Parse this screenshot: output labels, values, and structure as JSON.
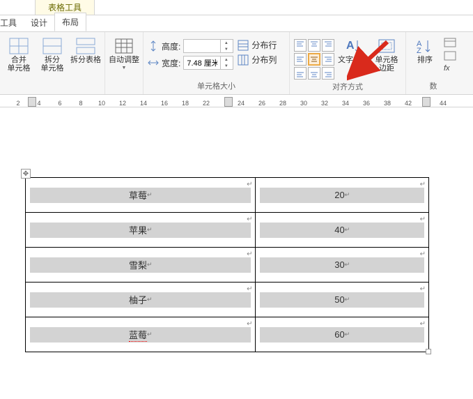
{
  "contextTab": "表格工具",
  "tabs": {
    "tools": "工具",
    "design": "设计",
    "layout": "布局"
  },
  "ribbon": {
    "merge": {
      "mergeCells": "合并\n单元格",
      "splitCells": "拆分\n单元格",
      "splitTable": "拆分表格",
      "groupLabel": ""
    },
    "autofit": {
      "label": "自动调整"
    },
    "cellSize": {
      "heightLabel": "高度:",
      "heightValue": "",
      "widthLabel": "宽度:",
      "widthValue": "7.48 厘米",
      "distRows": "分布行",
      "distCols": "分布列",
      "groupLabel": "单元格大小"
    },
    "alignment": {
      "textDir": "文字方向",
      "cellMargins": "单元格\n边距",
      "groupLabel": "对齐方式"
    },
    "data": {
      "sort": "排序",
      "fx": "fx",
      "groupLabel": "数"
    }
  },
  "rulerTicks": [
    "2",
    "4",
    "6",
    "8",
    "10",
    "12",
    "14",
    "16",
    "18",
    "22",
    "24",
    "26",
    "28",
    "30",
    "32",
    "34",
    "36",
    "38",
    "42",
    "44"
  ],
  "table": {
    "rows": [
      {
        "c1": "草莓",
        "c2": "20"
      },
      {
        "c1": "苹果",
        "c2": "40"
      },
      {
        "c1": "雪梨",
        "c2": "30"
      },
      {
        "c1": "柚子",
        "c2": "50"
      },
      {
        "c1": "蓝莓",
        "c2": "60",
        "squiggle": true
      }
    ]
  }
}
